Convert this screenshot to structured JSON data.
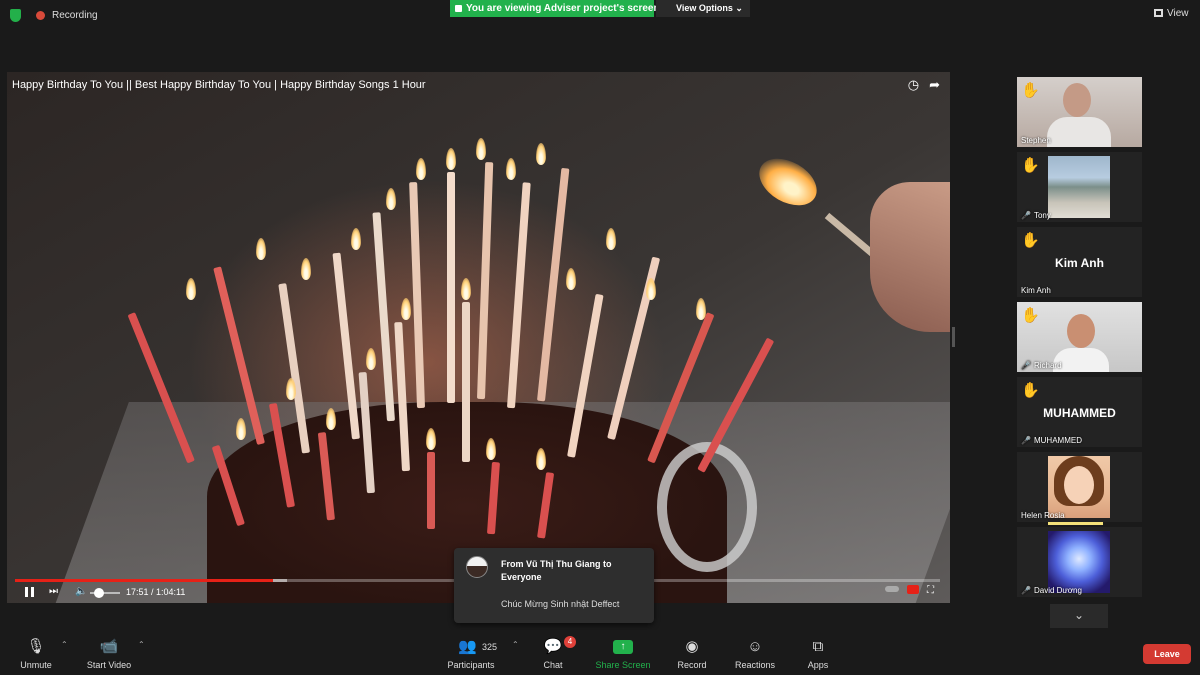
{
  "topbar": {
    "recording_label": "Recording",
    "share_banner": "You are viewing Adviser  project's screen",
    "view_options": "View Options",
    "view_label": "View"
  },
  "video": {
    "title": "Happy Birthday To You || Best Happy Birthday To You | Happy Birthday Songs 1 Hour",
    "time": "17:51 / 1:04:11",
    "progress": 0.279
  },
  "participants": [
    {
      "name": "Stephen",
      "muted": false,
      "hand_raised": true,
      "display": "video"
    },
    {
      "name": "Tony",
      "muted": true,
      "hand_raised": true,
      "display": "picture"
    },
    {
      "name": "Kim Anh",
      "muted": false,
      "hand_raised": true,
      "display": "name",
      "big_name": "Kim Anh"
    },
    {
      "name": "Richard",
      "muted": true,
      "hand_raised": true,
      "display": "video"
    },
    {
      "name": "MUHAMMED",
      "muted": true,
      "hand_raised": true,
      "display": "name",
      "big_name": "MUHAMMED"
    },
    {
      "name": "Helen Rosia",
      "muted": false,
      "hand_raised": false,
      "display": "picture"
    },
    {
      "name": "David Dương",
      "muted": true,
      "hand_raised": false,
      "display": "picture"
    }
  ],
  "chat_notification": {
    "from": "From Vũ Thị Thu Giang to Everyone",
    "message": "Chúc Mừng Sinh nhật Deffect"
  },
  "toolbar": {
    "unmute": "Unmute",
    "start_video": "Start Video",
    "participants": "Participants",
    "participants_count": "325",
    "chat": "Chat",
    "chat_badge": "4",
    "share_screen": "Share Screen",
    "record": "Record",
    "reactions": "Reactions",
    "apps": "Apps",
    "leave": "Leave"
  },
  "colors": {
    "share_green": "#22b14c",
    "leave_red": "#d43a32",
    "progress_red": "#e62117"
  }
}
